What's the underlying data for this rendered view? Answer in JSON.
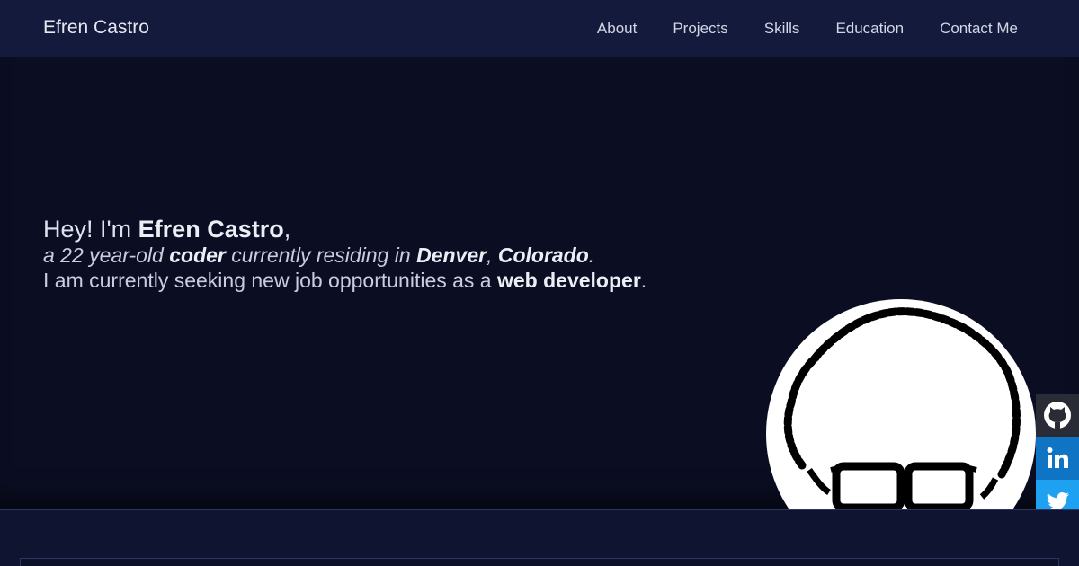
{
  "nav": {
    "brand": "Efren Castro",
    "links": [
      "About",
      "Projects",
      "Skills",
      "Education",
      "Contact Me"
    ]
  },
  "hero": {
    "line1": {
      "prefix": "Hey! I'm ",
      "name": "Efren Castro",
      "suffix": ","
    },
    "line2": {
      "a": "a 22 year-old ",
      "coder": "coder",
      "b": " currently residing in ",
      "city": "Denver",
      "comma": ", ",
      "state": "Colorado",
      "end": "."
    },
    "line3": {
      "a": "I am currently seeking new job opportunities as a ",
      "role": "web developer",
      "end": "."
    }
  },
  "social": [
    "github-icon",
    "linkedin-icon",
    "twitter-icon"
  ],
  "colors": {
    "background": "#0b0e22",
    "navbar": "#131a3c",
    "github": "#2a2c35",
    "linkedin": "#0f74c4",
    "twitter": "#1ea1f1"
  }
}
